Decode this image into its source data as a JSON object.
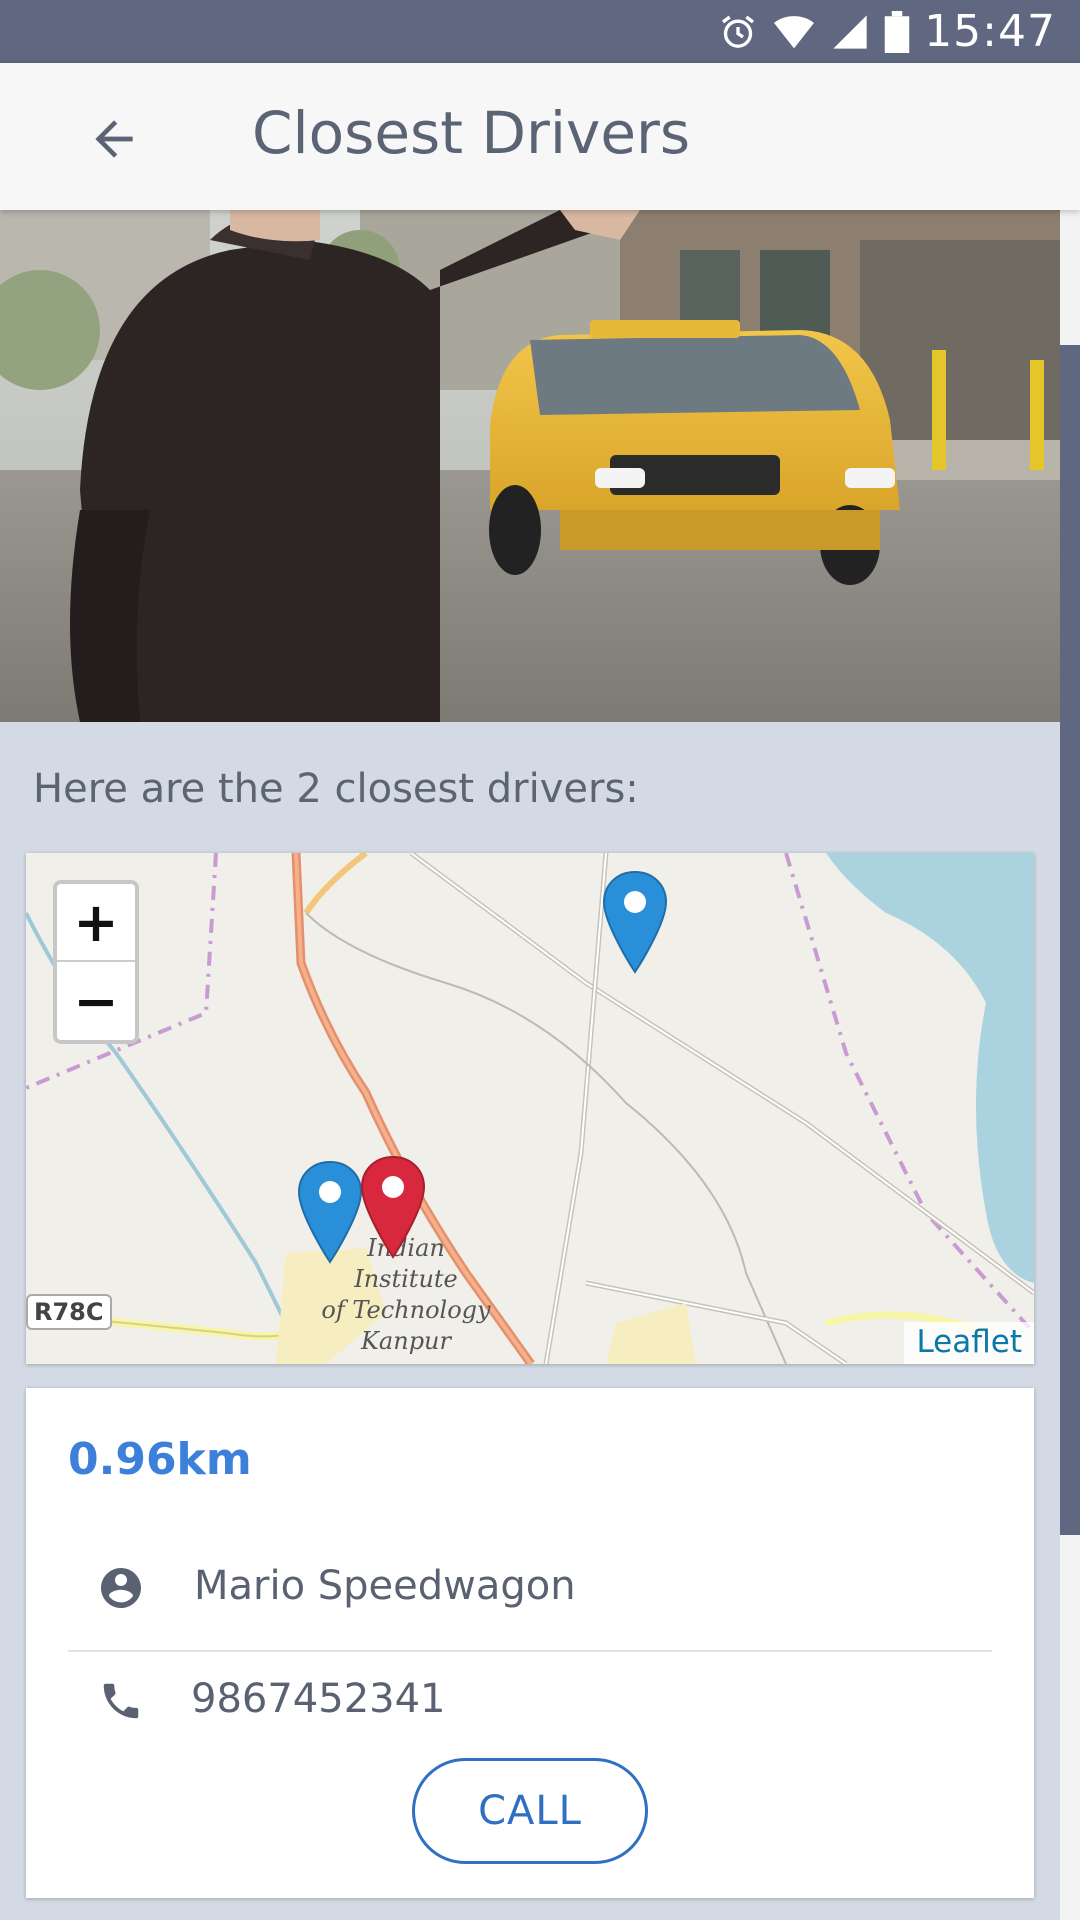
{
  "status_bar": {
    "time": "15:47",
    "icons": [
      "alarm-icon",
      "wifi-icon",
      "cell-signal-icon",
      "battery-icon"
    ]
  },
  "app_bar": {
    "title": "Closest Drivers",
    "back_icon": "arrow-back-icon"
  },
  "hero": {
    "image": "person hailing yellow taxi"
  },
  "intro": {
    "text": "Here are the 2 closest drivers:"
  },
  "map": {
    "zoom_in": "+",
    "zoom_out": "−",
    "attribution": "Leaflet",
    "road_label": "R78C",
    "place_label_lines": [
      "Indian",
      "Institute",
      "of Technology",
      "Kanpur"
    ],
    "markers": [
      {
        "color": "blue",
        "icon": "map-pin-icon"
      },
      {
        "color": "blue",
        "icon": "map-pin-icon"
      },
      {
        "color": "red",
        "icon": "map-pin-icon"
      }
    ]
  },
  "driver": {
    "distance": "0.96km",
    "name": "Mario Speedwagon",
    "phone": "9867452341",
    "call_label": "CALL"
  },
  "colors": {
    "status_bar": "#5f6880",
    "accent": "#3d80d9",
    "call_button": "#2f6fc4",
    "background": "#d3dae5"
  }
}
